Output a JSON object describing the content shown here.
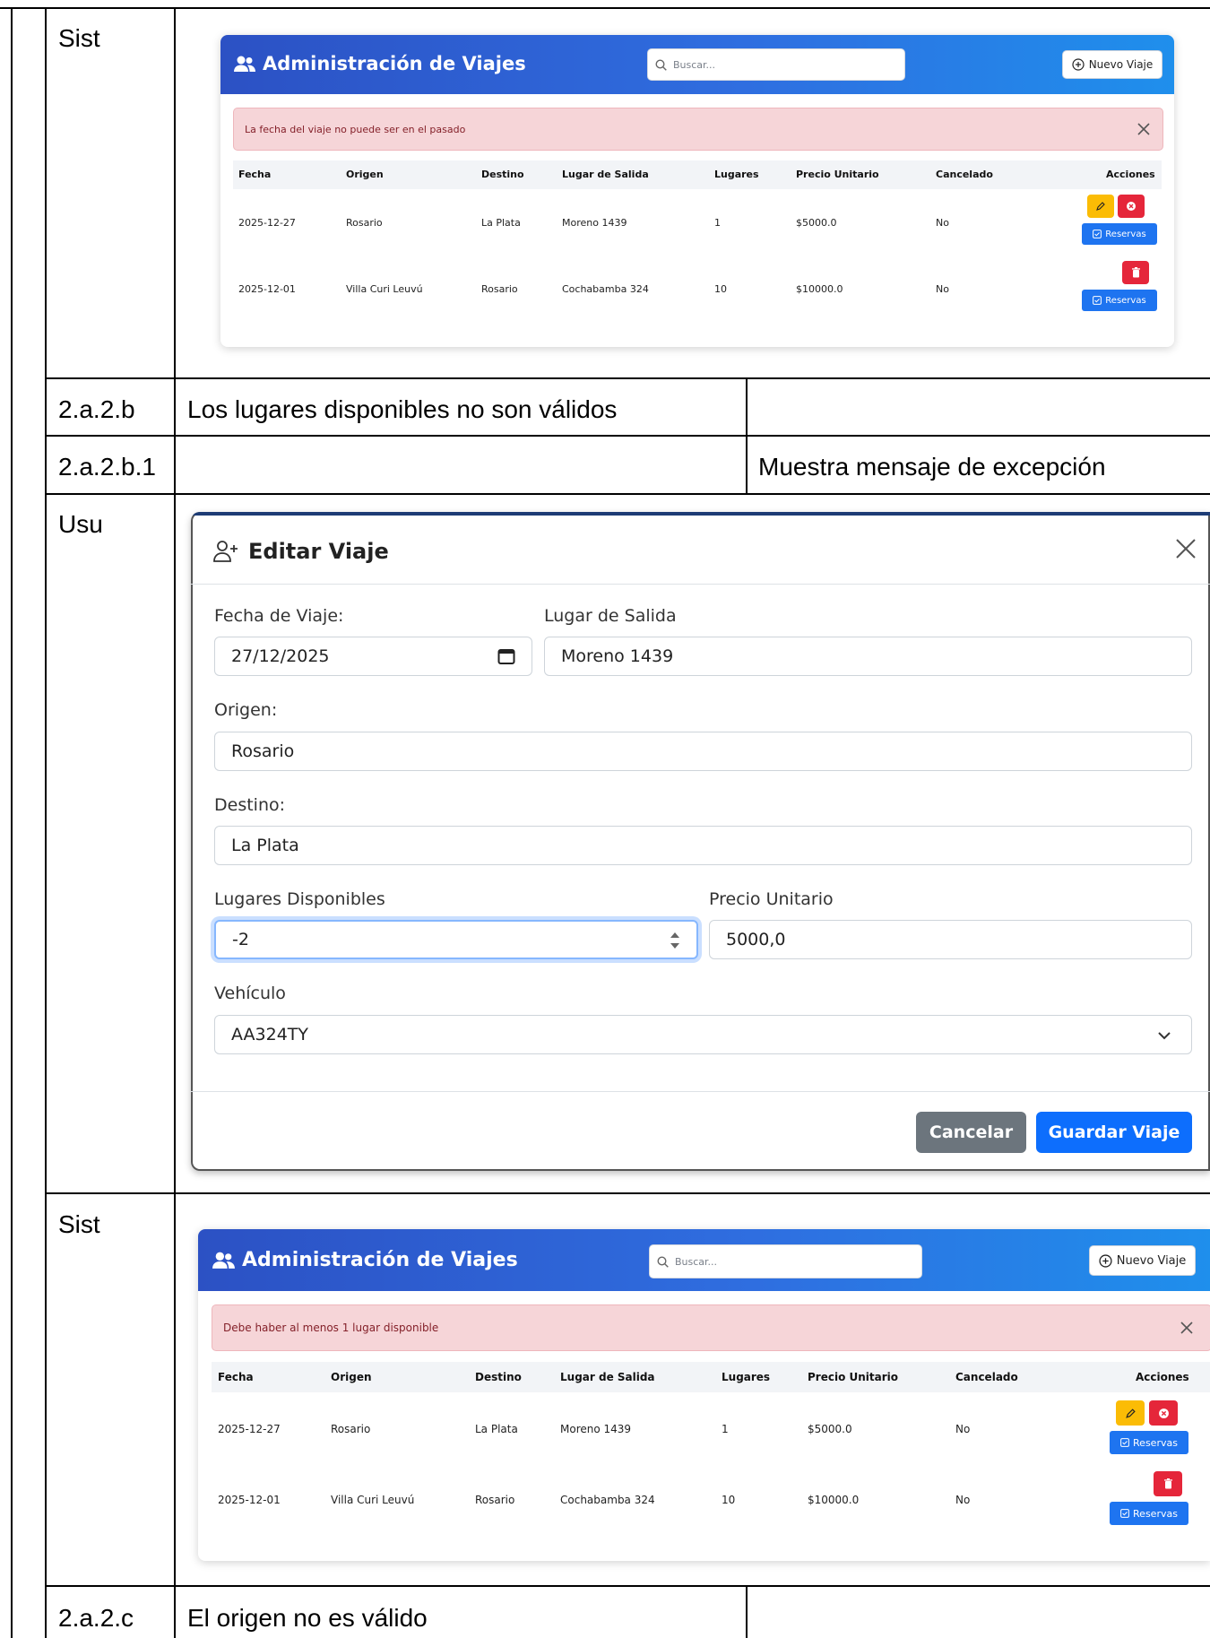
{
  "rows": {
    "r1_actor": "Sist",
    "r2_code": "2.a.2.b",
    "r2_desc": "Los lugares disponibles no son válidos",
    "r3_code": "2.a.2.b.1",
    "r3_result": "Muestra mensaje de excepción",
    "r4_actor": "Usu",
    "r5_actor": "Sist",
    "r6_code": "2.a.2.c",
    "r6_desc": "El origen no es válido"
  },
  "panel_common": {
    "title": "Administración de Viajes",
    "search_placeholder": "Buscar...",
    "new_button": "Nuevo Viaje",
    "reservas_label": "Reservas",
    "headers": [
      "Fecha",
      "Origen",
      "Destino",
      "Lugar de Salida",
      "Lugares",
      "Precio Unitario",
      "Cancelado",
      "Acciones"
    ],
    "rows": [
      [
        "2025-12-27",
        "Rosario",
        "La Plata",
        "Moreno 1439",
        "1",
        "$5000.0",
        "No"
      ],
      [
        "2025-12-01",
        "Villa Curi Leuvú",
        "Rosario",
        "Cochabamba 324",
        "10",
        "$10000.0",
        "No"
      ]
    ]
  },
  "panel1": {
    "alert": "La fecha del viaje no puede ser en el pasado"
  },
  "panel2": {
    "alert": "Debe haber al menos 1 lugar disponible"
  },
  "modal": {
    "title": "Editar Viaje",
    "fecha_label": "Fecha de Viaje:",
    "fecha_value": "27/12/2025",
    "salida_label": "Lugar de Salida",
    "salida_value": "Moreno 1439",
    "origen_label": "Origen:",
    "origen_value": "Rosario",
    "destino_label": "Destino:",
    "destino_value": "La Plata",
    "lugares_label": "Lugares Disponibles",
    "lugares_value": "-2",
    "precio_label": "Precio Unitario",
    "precio_value": "5000,0",
    "vehiculo_label": "Vehículo",
    "vehiculo_value": "AA324TY",
    "cancel_button": "Cancelar",
    "save_button": "Guardar Viaje"
  },
  "colors": {
    "header_gradient_start": "#2c51c4",
    "header_gradient_end": "#1f8fec",
    "alert_bg": "#f6d5d8",
    "alert_text": "#842029",
    "primary": "#0d6efd",
    "secondary": "#6c757d",
    "warning": "#fbbc05",
    "danger": "#e5263a"
  },
  "icons": [
    "users-icon",
    "search-icon",
    "plus-circle-icon",
    "close-icon",
    "pencil-icon",
    "x-circle-icon",
    "trash-icon",
    "check-square-icon",
    "user-plus-icon",
    "calendar-icon",
    "spinner-arrows-icon",
    "chevron-down-icon"
  ]
}
